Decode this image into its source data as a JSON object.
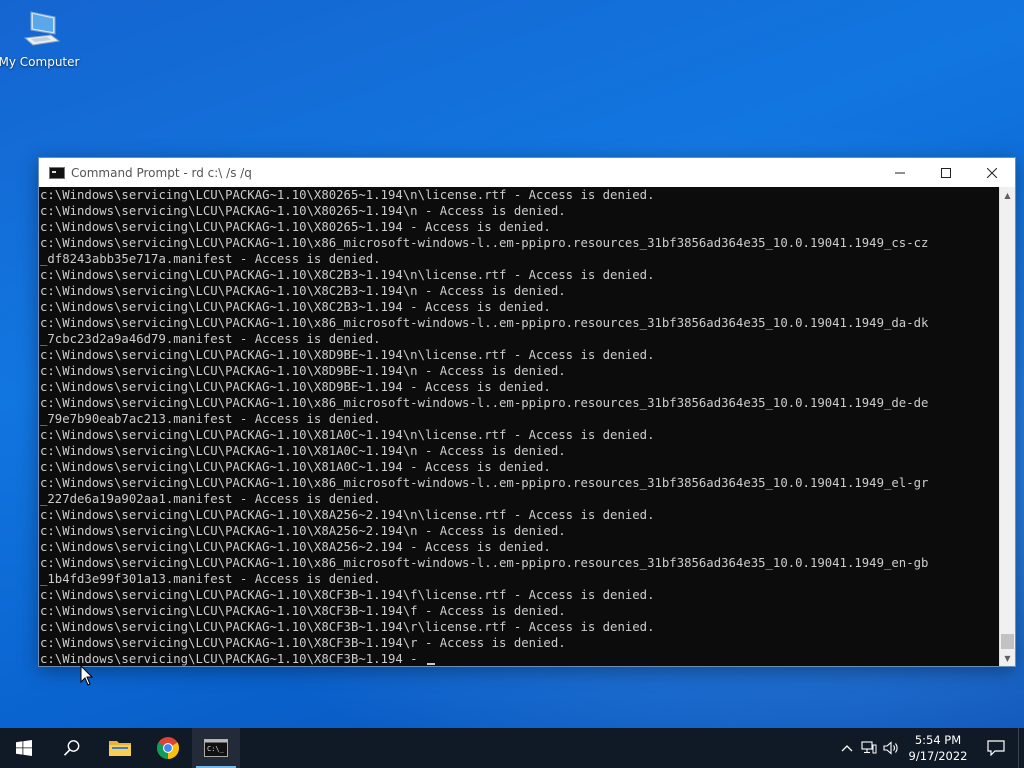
{
  "desktop": {
    "icons": [
      {
        "label": "My Computer",
        "icon": "computer-icon"
      }
    ]
  },
  "window": {
    "title": "Command Prompt - rd  c:\\ /s /q",
    "controls": [
      "minimize-icon",
      "maximize-icon",
      "close-icon"
    ]
  },
  "console": {
    "lines": [
      "c:\\Windows\\servicing\\LCU\\PACKAG~1.10\\X80265~1.194\\n\\license.rtf - Access is denied.",
      "c:\\Windows\\servicing\\LCU\\PACKAG~1.10\\X80265~1.194\\n - Access is denied.",
      "c:\\Windows\\servicing\\LCU\\PACKAG~1.10\\X80265~1.194 - Access is denied.",
      "c:\\Windows\\servicing\\LCU\\PACKAG~1.10\\x86_microsoft-windows-l..em-ppipro.resources_31bf3856ad364e35_10.0.19041.1949_cs-cz",
      "_df8243abb35e717a.manifest - Access is denied.",
      "c:\\Windows\\servicing\\LCU\\PACKAG~1.10\\X8C2B3~1.194\\n\\license.rtf - Access is denied.",
      "c:\\Windows\\servicing\\LCU\\PACKAG~1.10\\X8C2B3~1.194\\n - Access is denied.",
      "c:\\Windows\\servicing\\LCU\\PACKAG~1.10\\X8C2B3~1.194 - Access is denied.",
      "c:\\Windows\\servicing\\LCU\\PACKAG~1.10\\x86_microsoft-windows-l..em-ppipro.resources_31bf3856ad364e35_10.0.19041.1949_da-dk",
      "_7cbc23d2a9a46d79.manifest - Access is denied.",
      "c:\\Windows\\servicing\\LCU\\PACKAG~1.10\\X8D9BE~1.194\\n\\license.rtf - Access is denied.",
      "c:\\Windows\\servicing\\LCU\\PACKAG~1.10\\X8D9BE~1.194\\n - Access is denied.",
      "c:\\Windows\\servicing\\LCU\\PACKAG~1.10\\X8D9BE~1.194 - Access is denied.",
      "c:\\Windows\\servicing\\LCU\\PACKAG~1.10\\x86_microsoft-windows-l..em-ppipro.resources_31bf3856ad364e35_10.0.19041.1949_de-de",
      "_79e7b90eab7ac213.manifest - Access is denied.",
      "c:\\Windows\\servicing\\LCU\\PACKAG~1.10\\X81A0C~1.194\\n\\license.rtf - Access is denied.",
      "c:\\Windows\\servicing\\LCU\\PACKAG~1.10\\X81A0C~1.194\\n - Access is denied.",
      "c:\\Windows\\servicing\\LCU\\PACKAG~1.10\\X81A0C~1.194 - Access is denied.",
      "c:\\Windows\\servicing\\LCU\\PACKAG~1.10\\x86_microsoft-windows-l..em-ppipro.resources_31bf3856ad364e35_10.0.19041.1949_el-gr",
      "_227de6a19a902aa1.manifest - Access is denied.",
      "c:\\Windows\\servicing\\LCU\\PACKAG~1.10\\X8A256~2.194\\n\\license.rtf - Access is denied.",
      "c:\\Windows\\servicing\\LCU\\PACKAG~1.10\\X8A256~2.194\\n - Access is denied.",
      "c:\\Windows\\servicing\\LCU\\PACKAG~1.10\\X8A256~2.194 - Access is denied.",
      "c:\\Windows\\servicing\\LCU\\PACKAG~1.10\\x86_microsoft-windows-l..em-ppipro.resources_31bf3856ad364e35_10.0.19041.1949_en-gb",
      "_1b4fd3e99f301a13.manifest - Access is denied.",
      "c:\\Windows\\servicing\\LCU\\PACKAG~1.10\\X8CF3B~1.194\\f\\license.rtf - Access is denied.",
      "c:\\Windows\\servicing\\LCU\\PACKAG~1.10\\X8CF3B~1.194\\f - Access is denied.",
      "c:\\Windows\\servicing\\LCU\\PACKAG~1.10\\X8CF3B~1.194\\r\\license.rtf - Access is denied.",
      "c:\\Windows\\servicing\\LCU\\PACKAG~1.10\\X8CF3B~1.194\\r - Access is denied.",
      "c:\\Windows\\servicing\\LCU\\PACKAG~1.10\\X8CF3B~1.194 - "
    ],
    "text_color": "#cccccc",
    "background": "#0c0c0c"
  },
  "taskbar": {
    "buttons": [
      {
        "name": "start-button",
        "icon": "windows-logo-icon"
      },
      {
        "name": "search-button",
        "icon": "search-icon"
      },
      {
        "name": "file-explorer-button",
        "icon": "folder-icon"
      },
      {
        "name": "chrome-button",
        "icon": "chrome-icon"
      },
      {
        "name": "command-prompt-button",
        "icon": "command-prompt-icon",
        "active": true
      }
    ],
    "tray": {
      "icons": [
        "chevron-up-icon",
        "network-icon",
        "volume-icon"
      ],
      "time": "5:54 PM",
      "date": "9/17/2022",
      "notification_icon": "notification-icon"
    }
  }
}
